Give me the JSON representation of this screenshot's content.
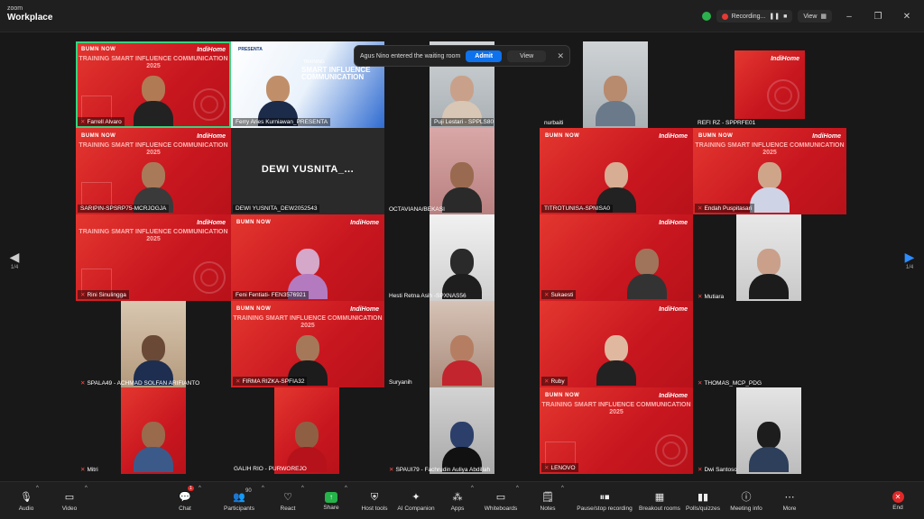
{
  "app": {
    "brand_small": "zoom",
    "brand_name": "Workplace"
  },
  "top_right": {
    "recording_label": "Recording...",
    "view_label": "View"
  },
  "waiting_toast": {
    "message": "Agus Nino entered the waiting room",
    "admit_label": "Admit",
    "view_label": "View",
    "close_icon": "close-icon"
  },
  "pager": {
    "left_label": "1/4",
    "right_label": "1/4"
  },
  "tile_branding": {
    "brand_line": "BUMN  NOW",
    "indihome": "IndiHome",
    "training_text": "TRAINING SMART INFLUENCE COMMUNICATION 2025"
  },
  "shared_slide": {
    "presenter": "PRESENTA",
    "training_label": "TRAINING",
    "title": "SMART INFLUENCE COMMUNICATION"
  },
  "participants": [
    {
      "name": "Farrell Alvaro",
      "muted": true
    },
    {
      "name": "Ferry Aries Kurniawan_PRESENTA",
      "muted": false
    },
    {
      "name": "Puji Lestari - SPPLS80",
      "muted": false
    },
    {
      "name": "nurbaiti",
      "muted": false
    },
    {
      "name": "REFI RZ - SPPRFE01",
      "muted": false
    },
    {
      "name": "SARIPIN-SPSRP75-MCRJOGJA",
      "muted": false
    },
    {
      "name": "DEWI YUSNITA_DEW2052543",
      "muted": false,
      "display_name": "DEWI YUSNITA_..."
    },
    {
      "name": "OCTAVIANA/BEKASI",
      "muted": false
    },
    {
      "name": "TITROTUNISA-SPNISA0",
      "muted": false
    },
    {
      "name": "Endah Puspitasari",
      "muted": true
    },
    {
      "name": "Rini Sinulingga",
      "muted": true
    },
    {
      "name": "Feni Fentiati- FEN3576921",
      "muted": false
    },
    {
      "name": "Hesti Retna Asih -SPXNAS56",
      "muted": false
    },
    {
      "name": "Sukaesti",
      "muted": true
    },
    {
      "name": "Mutiara",
      "muted": true
    },
    {
      "name": "SPALA49 - ACHMAD SOLFAN ARIFIANTO",
      "muted": true
    },
    {
      "name": "FIRMA RIZKA-SPFIA32",
      "muted": true
    },
    {
      "name": "Suryanih",
      "muted": false
    },
    {
      "name": "Ruby",
      "muted": true
    },
    {
      "name": "THOMAS_MCP_PDG",
      "muted": true
    },
    {
      "name": "Mitri",
      "muted": true
    },
    {
      "name": "GALIH RIO - PURWOREJO",
      "muted": false
    },
    {
      "name": "SPAUI79 - Fachrudin Auliya Abdillah",
      "muted": true
    },
    {
      "name": "LENOVO",
      "muted": true
    },
    {
      "name": "Dwi Santoso",
      "muted": true
    }
  ],
  "toolbar": {
    "audio": "Audio",
    "video": "Video",
    "chat": "Chat",
    "chat_badge": "1",
    "participants": "Participants",
    "participants_count": "90",
    "react": "React",
    "share": "Share",
    "host_tools": "Host tools",
    "ai_companion": "AI Companion",
    "apps": "Apps",
    "whiteboards": "Whiteboards",
    "notes": "Notes",
    "pause_recording": "Pause/stop recording",
    "breakout_rooms": "Breakout rooms",
    "polls": "Polls/quizzes",
    "meeting_info": "Meeting info",
    "more": "More",
    "end": "End"
  },
  "colors": {
    "accent_blue": "#0e72ed",
    "tile_red": "#d4202a",
    "share_green": "#25b34a",
    "end_red": "#e02828",
    "active_speaker": "#37d47e"
  }
}
